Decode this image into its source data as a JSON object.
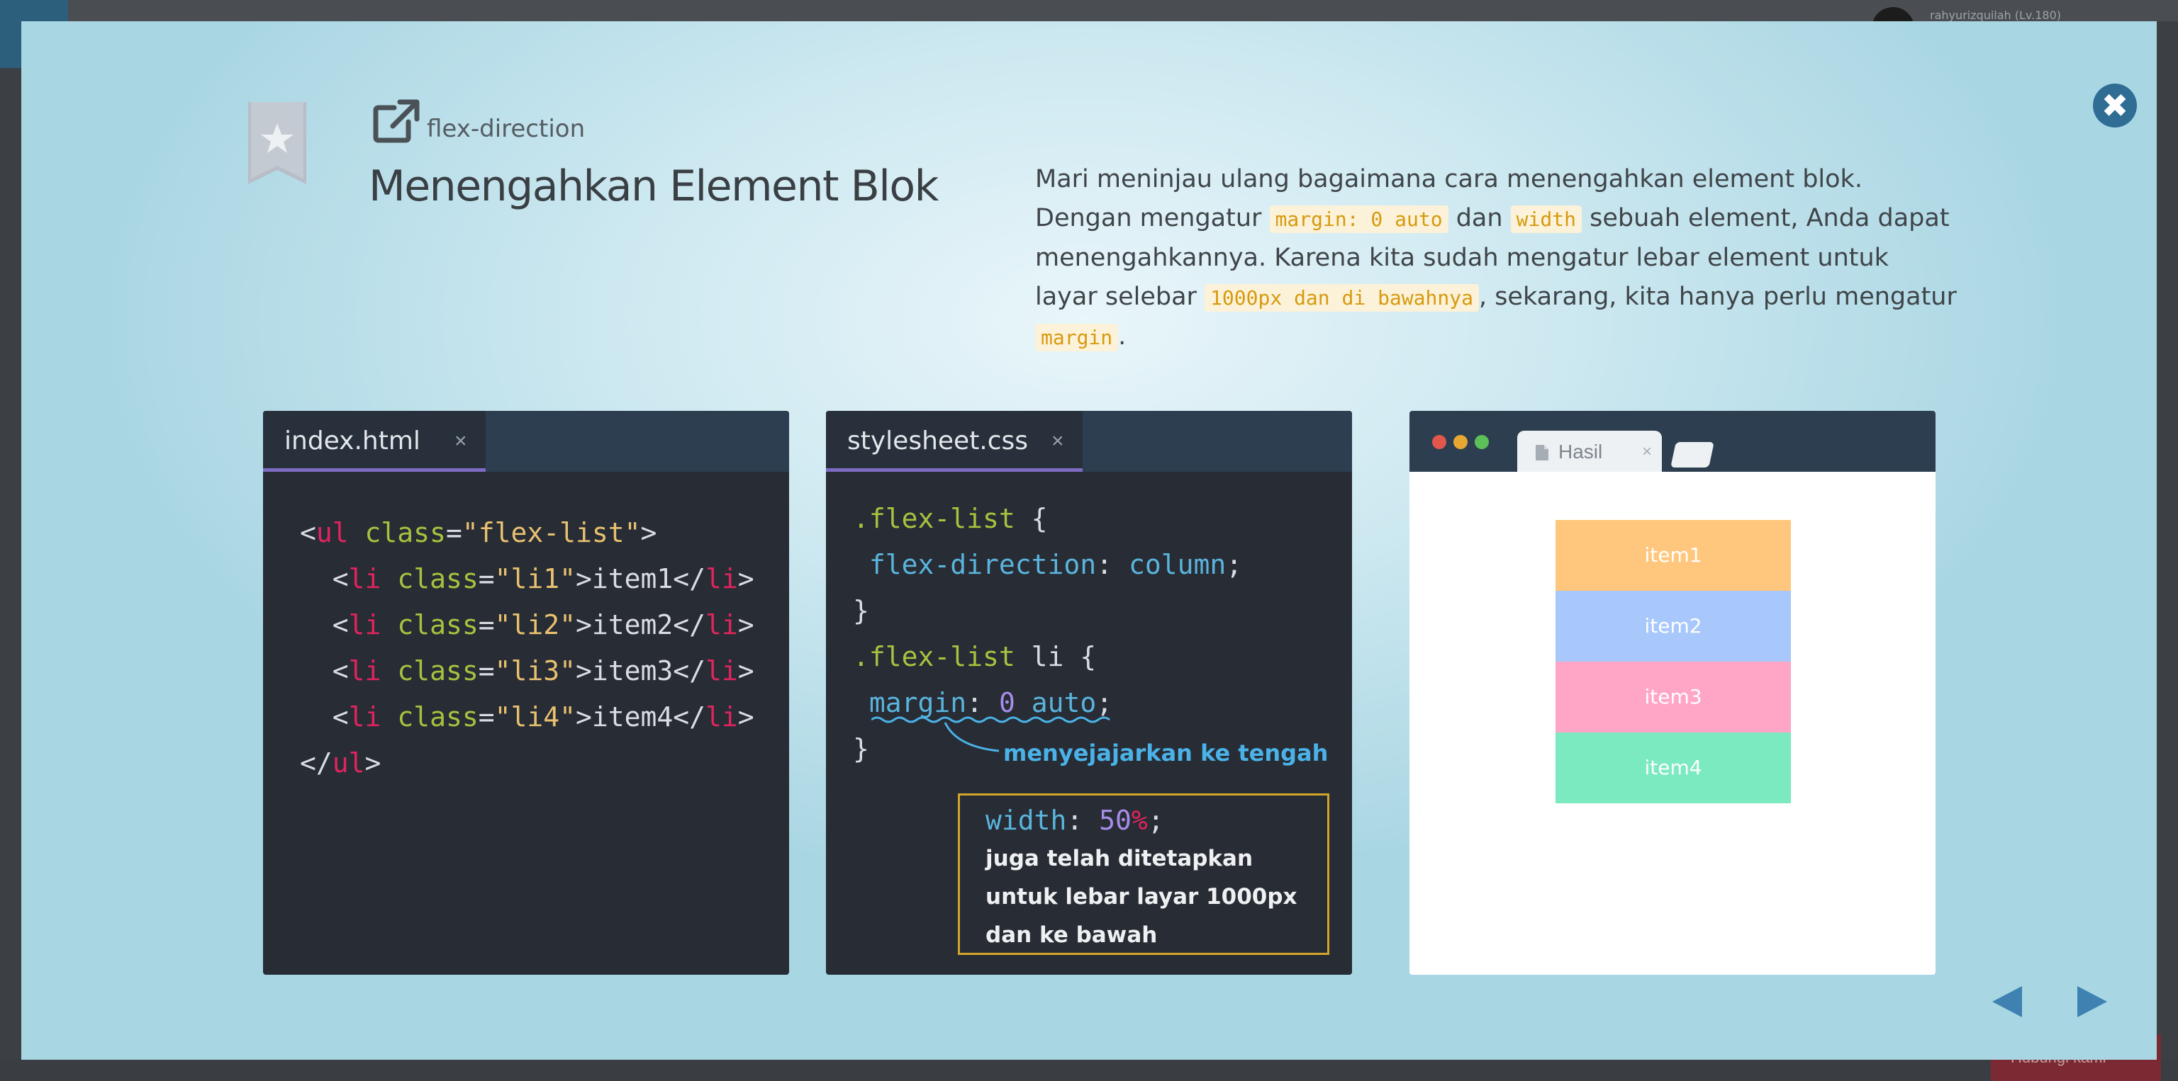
{
  "background": {
    "user_label": "rahyurizquilah (Lv.180)",
    "bottom_button_label": "Hubungi kami"
  },
  "header": {
    "topic": "flex-direction",
    "title": "Menengahkan Element Blok"
  },
  "description": {
    "parts": [
      {
        "type": "text",
        "text": "Mari meninjau ulang bagaimana cara menengahkan element blok. Dengan mengatur "
      },
      {
        "type": "code",
        "text": "margin: 0 auto"
      },
      {
        "type": "text",
        "text": " dan "
      },
      {
        "type": "code",
        "text": "width"
      },
      {
        "type": "text",
        "text": " sebuah element, Anda dapat menengahkannya. Karena kita sudah mengatur lebar element untuk layar selebar "
      },
      {
        "type": "code",
        "text": "1000px dan di bawahnya"
      },
      {
        "type": "text",
        "text": ", sekarang, kita hanya perlu mengatur "
      },
      {
        "type": "code",
        "text": "margin"
      },
      {
        "type": "text",
        "text": "."
      }
    ]
  },
  "html_panel": {
    "tab_label": "index.html",
    "tab_close": "×",
    "lines": [
      "<ul class=\"flex-list\">",
      "  <li class=\"li1\">item1</li>",
      "  <li class=\"li2\">item2</li>",
      "  <li class=\"li3\">item3</li>",
      "  <li class=\"li4\">item4</li>",
      "</ul>"
    ]
  },
  "css_panel": {
    "tab_label": "stylesheet.css",
    "tab_close": "×",
    "annotation": "menyejajarkan ke tengah",
    "note": "juga telah ditetapkan untuk lebar layar 1000px dan ke bawah"
  },
  "browser_panel": {
    "tab_label": "Hasil",
    "tab_close": "×",
    "dot_colors": [
      "#e2574c",
      "#e6a832",
      "#5cbf58"
    ],
    "items": [
      {
        "label": "item1",
        "color": "#ffc77e"
      },
      {
        "label": "item2",
        "color": "#a8c8fb"
      },
      {
        "label": "item3",
        "color": "#ffa6c6"
      },
      {
        "label": "item4",
        "color": "#7ceac0"
      }
    ]
  },
  "colors": {
    "close_button": "#2f6d95",
    "nav_arrow": "#3f82b2",
    "tab_underline": "#7e6bc4"
  }
}
